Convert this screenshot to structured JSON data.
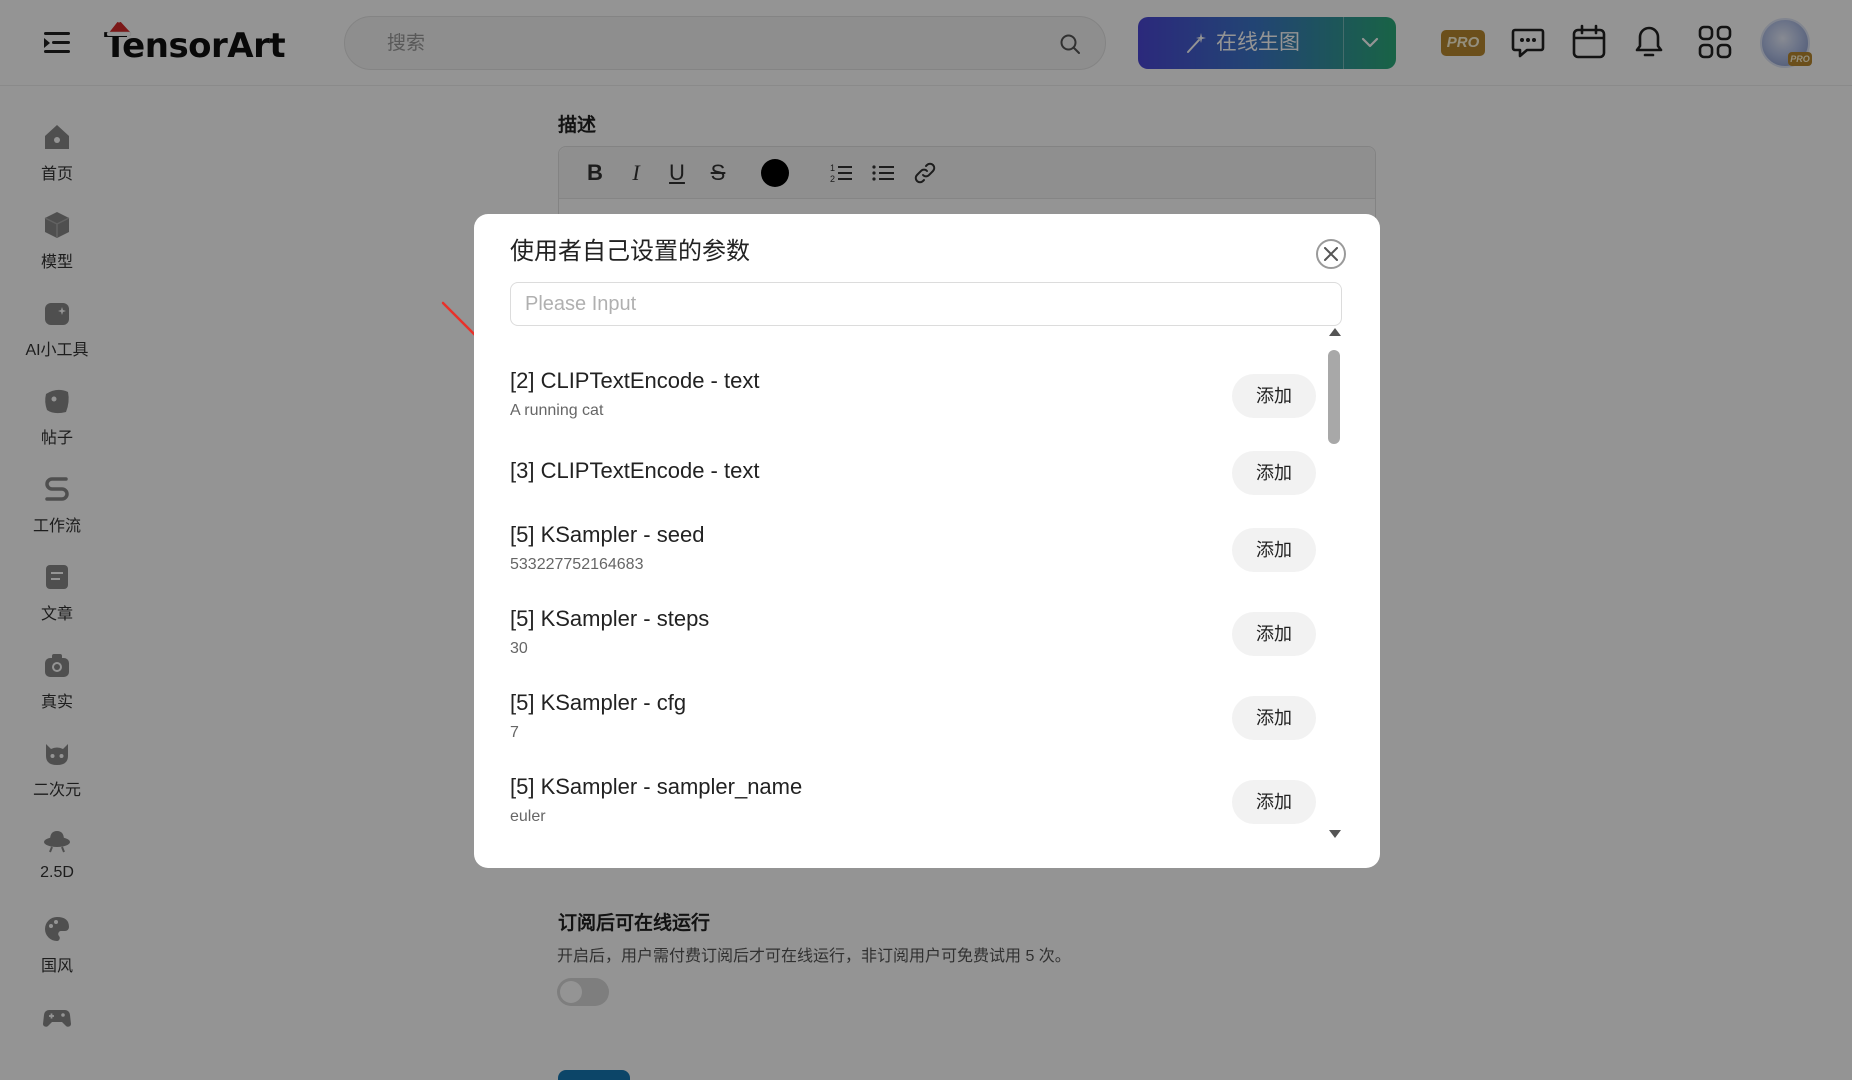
{
  "header": {
    "logo_text": "TensorArt",
    "search_placeholder": "搜索",
    "generate_label": "在线生图",
    "pro_label": "PRO",
    "icons": [
      "menu-toggle-icon",
      "search-icon",
      "wand-icon",
      "chevron-down-icon",
      "chat-icon",
      "calendar-icon",
      "bell-icon",
      "apps-grid-icon"
    ]
  },
  "sidebar": {
    "items": [
      {
        "label": "首页",
        "icon": "home-icon"
      },
      {
        "label": "模型",
        "icon": "cube-icon"
      },
      {
        "label": "AI小工具",
        "icon": "ai-tools-icon"
      },
      {
        "label": "帖子",
        "icon": "post-icon"
      },
      {
        "label": "工作流",
        "icon": "workflow-icon"
      },
      {
        "label": "文章",
        "icon": "article-icon"
      },
      {
        "label": "真实",
        "icon": "camera-icon"
      },
      {
        "label": "二次元",
        "icon": "anime-icon"
      },
      {
        "label": "2.5D",
        "icon": "ufo-icon"
      },
      {
        "label": "国风",
        "icon": "palette-icon"
      },
      {
        "label": "",
        "icon": "gamepad-icon"
      }
    ]
  },
  "background": {
    "description_title": "描述",
    "subscribe_title": "订阅后可在线运行",
    "subscribe_desc": "开启后，用户需付费订阅后才可在线运行，非订阅用户可免费试用 5 次。",
    "toolbar": {
      "bold": "B",
      "italic": "I",
      "underline": "U",
      "strike": "S"
    }
  },
  "modal": {
    "title": "使用者自己设置的参数",
    "input_placeholder": "Please Input",
    "add_label": "添加",
    "params": [
      {
        "title": "[2] CLIPTextEncode - text",
        "value": "A running cat"
      },
      {
        "title": "[3] CLIPTextEncode - text",
        "value": ""
      },
      {
        "title": "[5] KSampler - seed",
        "value": "533227752164683"
      },
      {
        "title": "[5] KSampler - steps",
        "value": "30"
      },
      {
        "title": "[5] KSampler - cfg",
        "value": "7"
      },
      {
        "title": "[5] KSampler - sampler_name",
        "value": "euler"
      }
    ]
  },
  "colors": {
    "overlay": "#000000",
    "annotation_arrow": "#e8322a",
    "gen_gradient_start": "#4b47d6",
    "gen_gradient_end": "#2bab79",
    "pro_gold": "#b8892f"
  }
}
